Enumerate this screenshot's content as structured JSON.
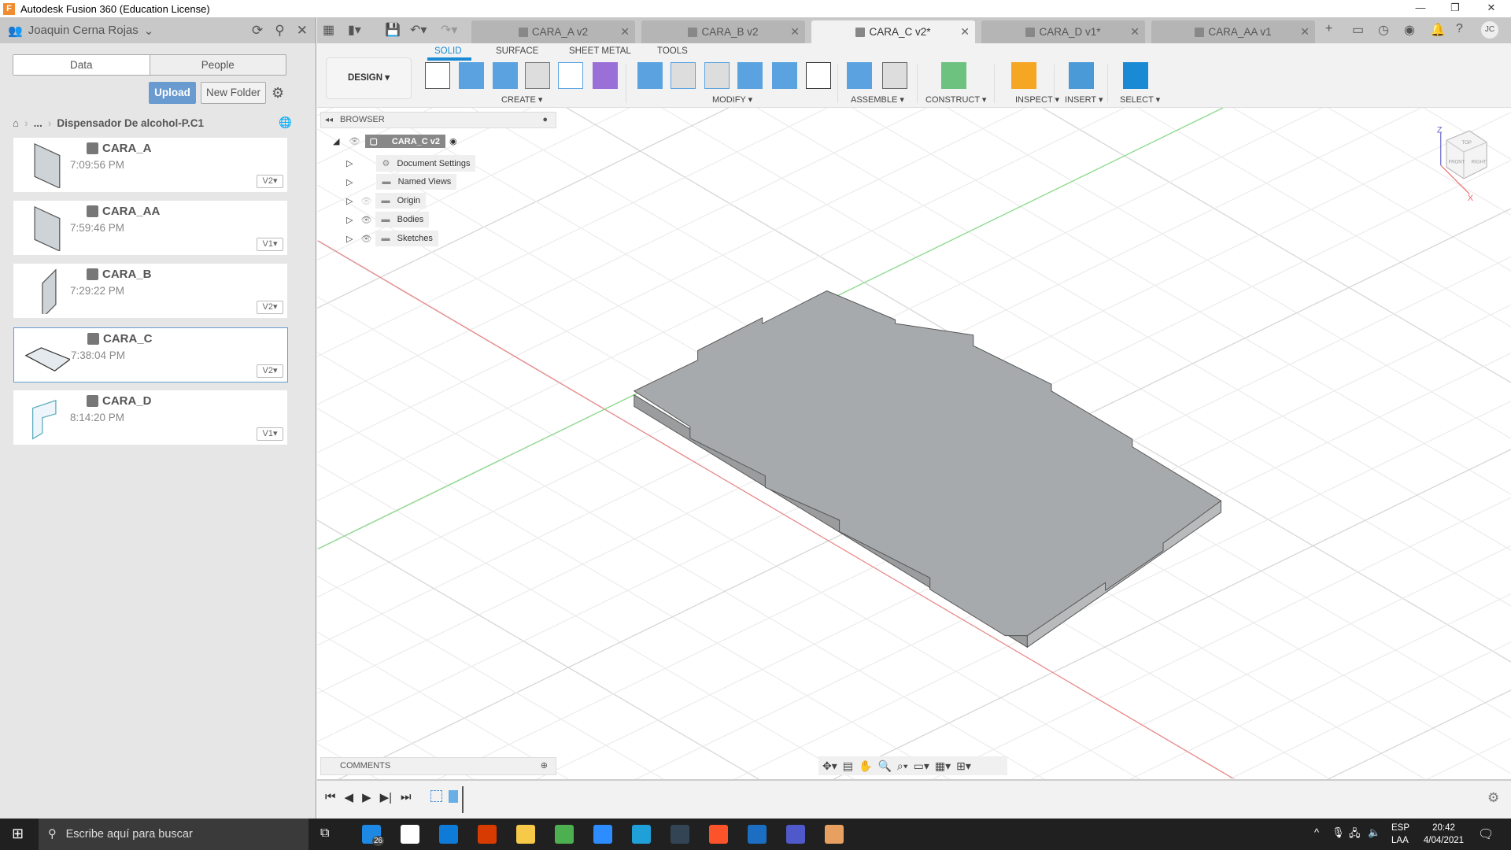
{
  "window": {
    "title": "Autodesk Fusion 360 (Education License)",
    "logo": "F"
  },
  "data_panel": {
    "user": "Joaquin Cerna Rojas",
    "tabs": [
      "Data",
      "People"
    ],
    "upload": "Upload",
    "new_folder": "New Folder",
    "breadcrumb": {
      "ellipsis": "...",
      "folder": "Dispensador De alcohol-P.C1"
    },
    "files": [
      {
        "name": "CARA_A",
        "time": "7:09:56 PM",
        "version": "V2"
      },
      {
        "name": "CARA_AA",
        "time": "7:59:46 PM",
        "version": "V1"
      },
      {
        "name": "CARA_B",
        "time": "7:29:22 PM",
        "version": "V2"
      },
      {
        "name": "CARA_C",
        "time": "7:38:04 PM",
        "version": "V2",
        "selected": true
      },
      {
        "name": "CARA_D",
        "time": "8:14:20 PM",
        "version": "V1"
      }
    ]
  },
  "doc_tabs": [
    {
      "label": "CARA_A v2"
    },
    {
      "label": "CARA_B v2"
    },
    {
      "label": "CARA_C v2*",
      "active": true
    },
    {
      "label": "CARA_D v1*"
    },
    {
      "label": "CARA_AA v1"
    }
  ],
  "ribbon": {
    "workspace": "DESIGN ▾",
    "tabs": [
      "SOLID",
      "SURFACE",
      "SHEET METAL",
      "TOOLS"
    ],
    "groups": [
      "CREATE ▾",
      "MODIFY ▾",
      "ASSEMBLE ▾",
      "CONSTRUCT ▾",
      "INSPECT ▾",
      "INSERT ▾",
      "SELECT ▾"
    ]
  },
  "browser": {
    "title": "BROWSER",
    "root": "CARA_C v2",
    "items": [
      "Document Settings",
      "Named Views",
      "Origin",
      "Bodies",
      "Sketches"
    ]
  },
  "comments": {
    "title": "COMMENTS"
  },
  "viewcube": {
    "faces": [
      "TOP",
      "FRONT",
      "RIGHT"
    ],
    "axes": [
      "Z",
      "X"
    ]
  },
  "taskbar": {
    "search_placeholder": "Escribe aquí para buscar",
    "badge": "26",
    "lang1": "ESP",
    "lang2": "LAA",
    "time": "20:42",
    "date": "4/04/2021"
  },
  "colors": {
    "accent": "#1a8ad4",
    "upload": "#6a9bd0",
    "x_axis": "#e05050",
    "y_axis": "#50c050"
  }
}
